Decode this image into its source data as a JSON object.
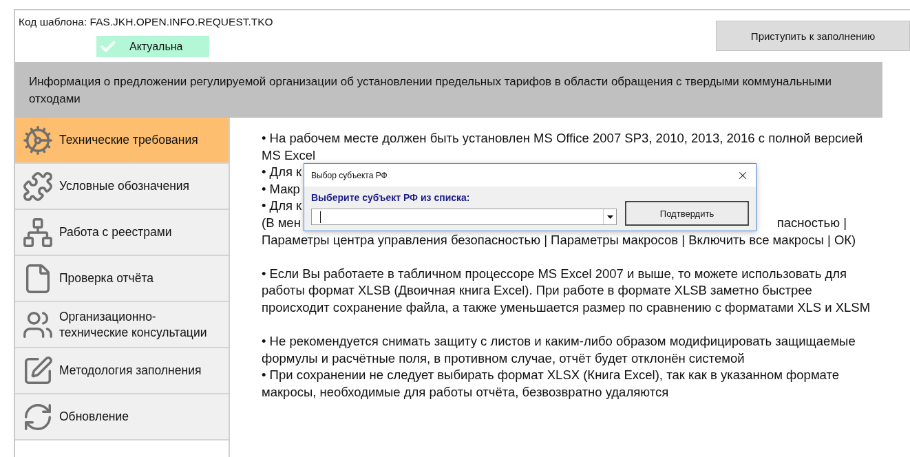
{
  "header": {
    "template_code": "Код шаблона: FAS.JKH.OPEN.INFO.REQUEST.TKO",
    "status": {
      "label": "Актуальна",
      "checked": true
    },
    "start_button": "Приступить к заполнению"
  },
  "banner": "Информация о предложении регулируемой организации об установлении предельных тарифов в области обращения с твердыми коммунальными отходами",
  "sidebar": {
    "items": [
      {
        "label": "Технические требования",
        "selected": true
      },
      {
        "label": "Условные обозначения",
        "selected": false
      },
      {
        "label": "Работа с реестрами",
        "selected": false
      },
      {
        "label": "Проверка отчёта",
        "selected": false
      },
      {
        "label": "Организационно-технические консультации",
        "selected": false
      },
      {
        "label": "Методология заполнения",
        "selected": false
      },
      {
        "label": "Обновление",
        "selected": false
      }
    ]
  },
  "content": {
    "paragraphs": [
      {
        "lines": [
          {
            "text": "• На рабочем месте должен быть установлен MS Office 2007 SP3, 2010, 2013, 2016 с полной версией"
          },
          {
            "text": "MS Excel"
          },
          {
            "text": "• Для к"
          },
          {
            "text": "• Макр"
          },
          {
            "text": "• Для к"
          },
          {
            "text": "(В мен",
            "right": "пасностью |"
          },
          {
            "text": "Параметры центра управления безопасностью | Параметры макросов | Включить все макросы | ОК)"
          }
        ]
      },
      {
        "lines": [
          {
            "text": "• Если Вы работаете в табличном процессоре MS Excel 2007 и выше, то можете использовать для"
          },
          {
            "text": "работы формат XLSB (Двоичная книга Excel). При работе в формате XLSB заметно быстрее"
          },
          {
            "text": "происходит сохранение файла, а также уменьшается размер по сравнению с форматами XLS и XLSM"
          }
        ]
      },
      {
        "lines": [
          {
            "text": "• Не рекомендуется снимать защиту с листов и каким-либо образом модифицировать защищаемые"
          },
          {
            "text": "формулы и расчётные поля, в противном случае, отчёт будет отклонён системой"
          },
          {
            "text": "• При сохранении не следует выбирать формат XLSX (Книга Excel), так как в указанном формате"
          },
          {
            "text": "макросы, необходимые для работы отчёта, безвозвратно удаляются"
          }
        ]
      }
    ]
  },
  "dialog": {
    "title": "Выбор субъекта РФ",
    "label": "Выберите субъект РФ из списка:",
    "confirm_button": "Подтвердить"
  }
}
